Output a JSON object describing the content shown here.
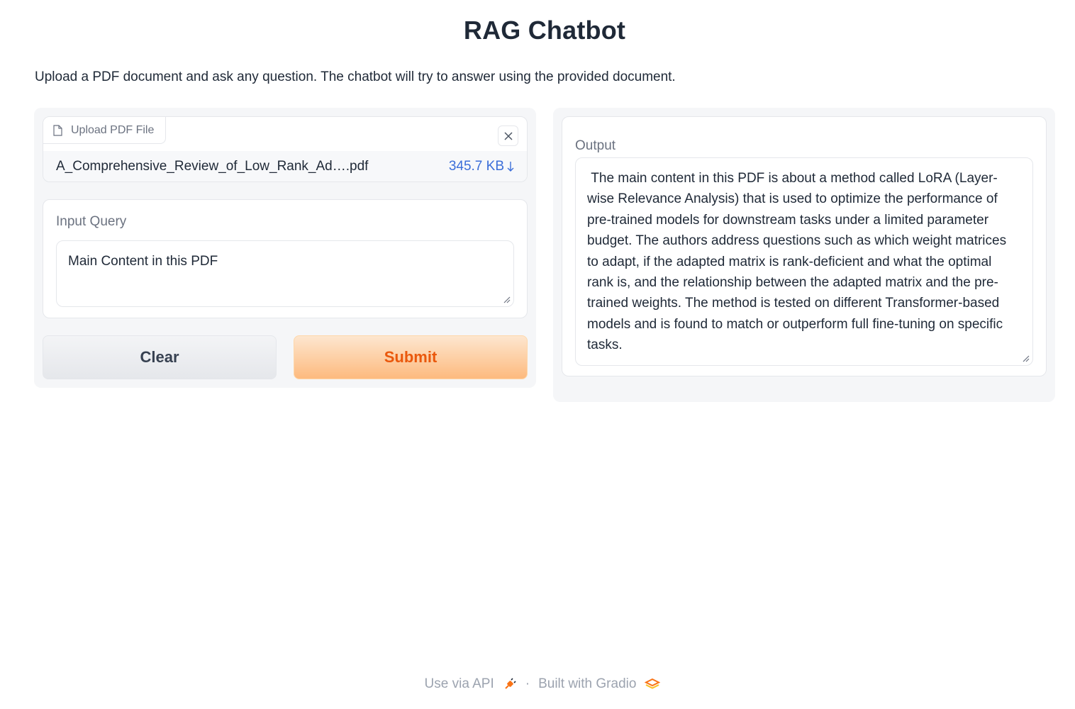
{
  "header": {
    "title": "RAG Chatbot",
    "description": "Upload a PDF document and ask any question. The chatbot will try to answer using the provided document."
  },
  "upload": {
    "tab_label": "Upload PDF File",
    "file_name": "A_Comprehensive_Review_of_Low_Rank_Ad….pdf",
    "file_size": "345.7 KB"
  },
  "query": {
    "label": "Input Query",
    "value": "Main Content in this PDF"
  },
  "buttons": {
    "clear_label": "Clear",
    "submit_label": "Submit"
  },
  "output": {
    "label": "Output",
    "value": " The main content in this PDF is about a method called LoRA (Layer-wise Relevance Analysis) that is used to optimize the performance of pre-trained models for downstream tasks under a limited parameter budget. The authors address questions such as which weight matrices to adapt, if the adapted matrix is rank-deficient and what the optimal rank is, and the relationship between the adapted matrix and the pre-trained weights. The method is tested on different Transformer-based models and is found to match or outperform full fine-tuning on specific tasks."
  },
  "footer": {
    "api_label": "Use via API",
    "separator": "·",
    "built_label": "Built with Gradio"
  },
  "colors": {
    "accent_orange": "#ea580c",
    "link_blue": "#3b6ed9"
  }
}
